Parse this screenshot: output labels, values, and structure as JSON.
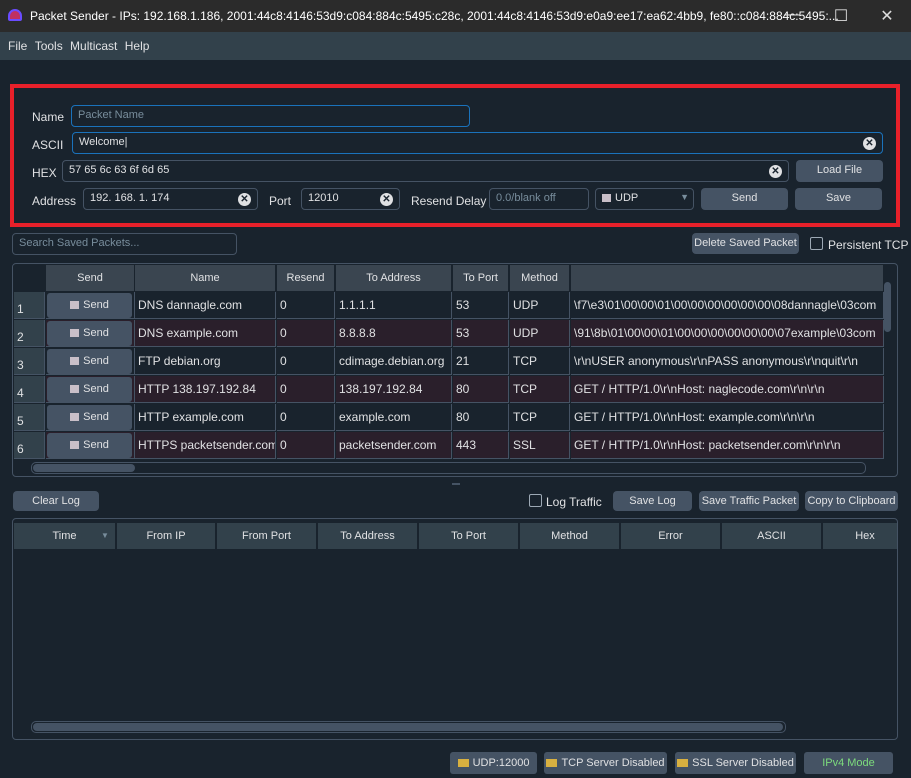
{
  "window": {
    "title": "Packet Sender - IPs: 192.168.1.186, 2001:44c8:4146:53d9:c084:884c:5495:c28c, 2001:44c8:4146:53d9:e0a9:ee17:ea62:4bb9, fe80::c084:884c:5495:...",
    "minimize": "—",
    "maximize": "☐",
    "close": "✕"
  },
  "menu": [
    "File",
    "Tools",
    "Multicast",
    "Help"
  ],
  "form": {
    "name_label": "Name",
    "name_placeholder": "Packet Name",
    "name_value": "",
    "ascii_label": "ASCII",
    "ascii_value": "Welcome",
    "hex_label": "HEX",
    "hex_value": "57 65 6c 63 6f 6d 65",
    "load_file": "Load File",
    "address_label": "Address",
    "address_value": "192. 168. 1. 174",
    "port_label": "Port",
    "port_value": "12010",
    "resend_label": "Resend Delay",
    "resend_placeholder": "0.0/blank off",
    "protocol": "UDP",
    "send": "Send",
    "save": "Save",
    "clear_glyph": "✕"
  },
  "saved": {
    "search_placeholder": "Search Saved Packets...",
    "delete": "Delete Saved Packet",
    "persistent_tcp": "Persistent TCP",
    "columns": [
      "Send",
      "Name",
      "Resend",
      "To Address",
      "To Port",
      "Method",
      ""
    ],
    "send_label": "Send",
    "rows": [
      {
        "n": "1",
        "name": "DNS dannagle.com",
        "resend": "0",
        "addr": "1.1.1.1",
        "port": "53",
        "method": "UDP",
        "data": "\\f7\\e3\\01\\00\\00\\01\\00\\00\\00\\00\\00\\00\\08dannagle\\03com"
      },
      {
        "n": "2",
        "name": "DNS example.com",
        "resend": "0",
        "addr": "8.8.8.8",
        "port": "53",
        "method": "UDP",
        "data": "\\91\\8b\\01\\00\\00\\01\\00\\00\\00\\00\\00\\00\\07example\\03com"
      },
      {
        "n": "3",
        "name": "FTP debian.org",
        "resend": "0",
        "addr": "cdimage.debian.org",
        "port": "21",
        "method": "TCP",
        "data": "\\r\\nUSER anonymous\\r\\nPASS anonymous\\r\\nquit\\r\\n"
      },
      {
        "n": "4",
        "name": "HTTP 138.197.192.84",
        "resend": "0",
        "addr": "138.197.192.84",
        "port": "80",
        "method": "TCP",
        "data": "GET / HTTP/1.0\\r\\nHost: naglecode.com\\r\\n\\r\\n"
      },
      {
        "n": "5",
        "name": "HTTP example.com",
        "resend": "0",
        "addr": "example.com",
        "port": "80",
        "method": "TCP",
        "data": "GET / HTTP/1.0\\r\\nHost: example.com\\r\\n\\r\\n"
      },
      {
        "n": "6",
        "name": "HTTPS packetsender.com",
        "resend": "0",
        "addr": "packetsender.com",
        "port": "443",
        "method": "SSL",
        "data": "GET / HTTP/1.0\\r\\nHost: packetsender.com\\r\\n\\r\\n"
      }
    ]
  },
  "log": {
    "clear": "Clear Log",
    "log_traffic": "Log Traffic",
    "save_log": "Save Log",
    "save_traffic_packet": "Save Traffic Packet",
    "copy": "Copy to Clipboard",
    "columns": [
      "Time",
      "From IP",
      "From Port",
      "To Address",
      "To Port",
      "Method",
      "Error",
      "ASCII",
      "Hex"
    ]
  },
  "status": {
    "udp": "UDP:12000",
    "tcp": "TCP Server Disabled",
    "ssl": "SSL Server Disabled",
    "ipv4": "IPv4 Mode"
  },
  "colors": {
    "background": "#19232d",
    "button": "#455364",
    "highlight_box": "#e8202a",
    "ipv4": "#7ddc7d",
    "row_alt": "#2a1f2b"
  }
}
